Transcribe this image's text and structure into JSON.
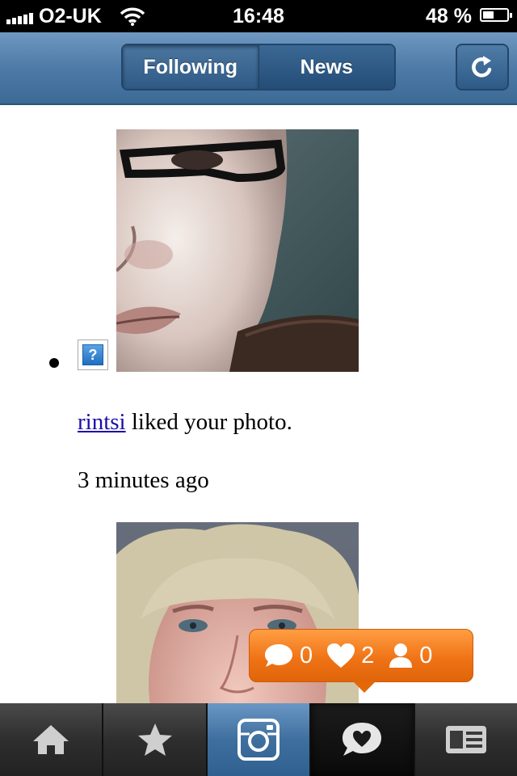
{
  "status_bar": {
    "carrier": "O2-UK",
    "time": "16:48",
    "battery_percent_label": "48 %",
    "battery_level": 0.48
  },
  "nav": {
    "tabs": [
      {
        "label": "Following",
        "active": true
      },
      {
        "label": "News",
        "active": false
      }
    ],
    "refresh_icon": "refresh-icon"
  },
  "feed": {
    "items": [
      {
        "user": "rintsi",
        "action": " liked your photo.",
        "time": "3 minutes ago"
      }
    ]
  },
  "notification": {
    "comments": "0",
    "likes": "2",
    "followers": "0"
  },
  "tab_bar": {
    "items": [
      {
        "icon": "home-icon"
      },
      {
        "icon": "star-icon"
      },
      {
        "icon": "camera-icon"
      },
      {
        "icon": "news-bubble-icon",
        "selected": true
      },
      {
        "icon": "profile-card-icon"
      }
    ]
  },
  "colors": {
    "nav_blue": "#4d7aa6",
    "notification_orange": "#f07416",
    "link": "#1a0dab"
  }
}
